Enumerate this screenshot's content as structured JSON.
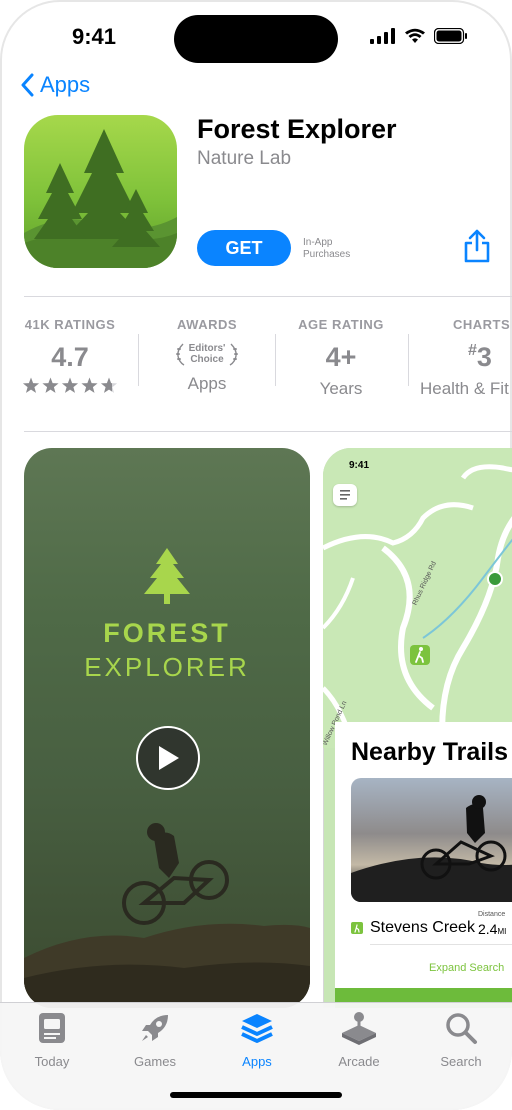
{
  "status": {
    "time": "9:41"
  },
  "nav": {
    "back_label": "Apps"
  },
  "app": {
    "title": "Forest Explorer",
    "developer": "Nature Lab",
    "get_label": "GET",
    "iap_line1": "In-App",
    "iap_line2": "Purchases"
  },
  "info": {
    "ratings": {
      "label": "41K RATINGS",
      "value": "4.7",
      "stars": 4.7
    },
    "awards": {
      "label": "AWARDS",
      "badge_line1": "Editors'",
      "badge_line2": "Choice",
      "sub": "Apps"
    },
    "age": {
      "label": "AGE RATING",
      "value": "4+",
      "sub": "Years"
    },
    "charts": {
      "label": "CHARTS",
      "value_prefix": "#",
      "value": "3",
      "sub": "Health & Fit"
    }
  },
  "screenshot1": {
    "line1": "FOREST",
    "line2": "EXPLORER"
  },
  "screenshot2": {
    "time": "9:41",
    "road1": "Rhus Ridge Rd",
    "road2": "Willow Pond Ln",
    "card_title": "Nearby Trails",
    "trail_name": "Stevens Creek",
    "distance_label": "Distance",
    "distance_value": "2.4",
    "distance_unit": "MI",
    "expand_label": "Expand Search"
  },
  "tabs": [
    {
      "label": "Today",
      "icon": "today-icon",
      "active": false
    },
    {
      "label": "Games",
      "icon": "rocket-icon",
      "active": false
    },
    {
      "label": "Apps",
      "icon": "apps-stack-icon",
      "active": true
    },
    {
      "label": "Arcade",
      "icon": "joystick-icon",
      "active": false
    },
    {
      "label": "Search",
      "icon": "search-icon",
      "active": false
    }
  ],
  "colors": {
    "accent": "#0a84ff",
    "app_green": "#7fc23a",
    "trail_green": "#a8d64c"
  }
}
